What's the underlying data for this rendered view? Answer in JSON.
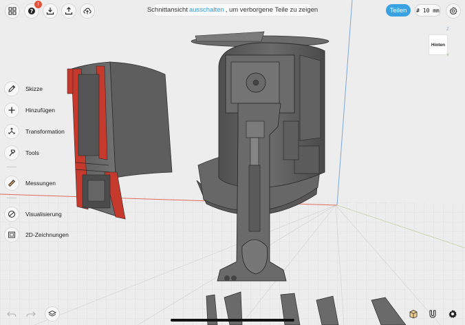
{
  "top_bar": {
    "help_badge": "!",
    "hint": {
      "prefix": "Schnittansicht",
      "link": "ausschalten",
      "suffix": ", um verborgene Teile zu zeigen"
    },
    "share_label": "Teilen",
    "grid_size": "# 10 mm"
  },
  "view_cube": {
    "face_label": "Hinten",
    "axis_z": "Z",
    "axis_y": "Y"
  },
  "side_menu": {
    "items": [
      {
        "label": "Skizze",
        "icon": "pencil-icon"
      },
      {
        "label": "Hinzufügen",
        "icon": "plus-icon"
      },
      {
        "label": "Transformation",
        "icon": "move-arrows-icon"
      },
      {
        "label": "Tools",
        "icon": "hammer-icon"
      },
      {
        "label": "Messungen",
        "icon": "ruler-icon"
      },
      {
        "label": "Visualisierung",
        "icon": "visualization-icon"
      },
      {
        "label": "2D-Zeichnungen",
        "icon": "drawing-icon"
      }
    ]
  },
  "colors": {
    "accent": "#3aa2e3",
    "badge": "#e2513b",
    "model_gray": "#5c5c5c",
    "model_red": "#c63a2d",
    "axis_red": "#e26a5a",
    "axis_blue": "#7aa6d6"
  }
}
